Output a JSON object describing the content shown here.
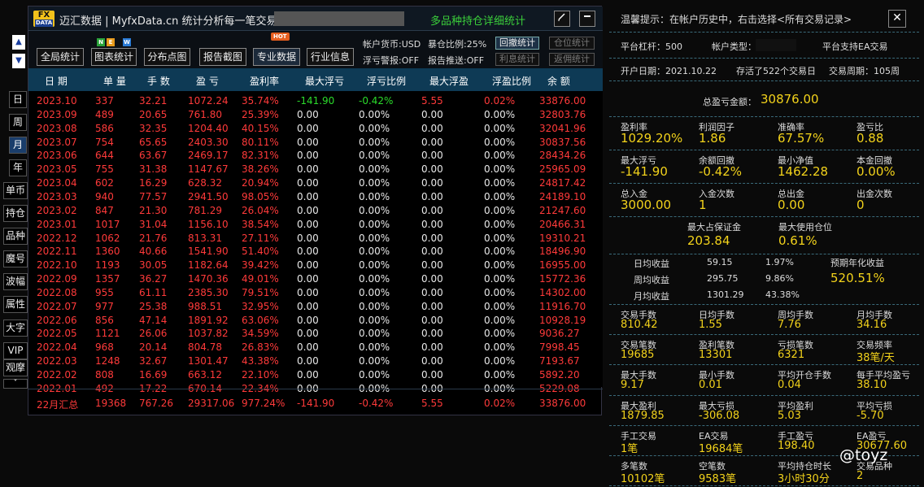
{
  "window": {
    "logo_top": "FX",
    "logo_bottom": "DATA",
    "title": "迈汇数据 | MyfxData.cn  统计分析每一笔交易",
    "subtitle": "多品种持仓详细统计",
    "edit_icon": "edit-icon",
    "minimize_icon": "minimize-icon"
  },
  "toolbar": {
    "buttons": [
      "全局统计",
      "图表统计",
      "分布点图",
      "报告截图",
      "专业数据",
      "行业信息"
    ],
    "badge_new": [
      "N",
      "E",
      "W"
    ],
    "badge_hot": "HOT",
    "account_currency": "帐户货币:USD",
    "exposure_ratio": "暴仓比例:25%",
    "float_warning": "浮亏警报:OFF",
    "report_push": "报告推送:OFF",
    "small_buttons": [
      "回撤统计",
      "仓位统计",
      "利息统计",
      "返佣统计"
    ]
  },
  "nav": {
    "up_icon": "▲",
    "down_icon": "▼",
    "items": [
      "日",
      "周",
      "月",
      "年",
      "单币",
      "持仓",
      "品种",
      "魔号",
      "波幅",
      "属性",
      "大字",
      "VIP",
      "观摩"
    ],
    "selected": "月",
    "more_icon": "˅"
  },
  "table": {
    "headers": [
      "日 期",
      "单 量",
      "手 数",
      "盈 亏",
      "盈利率",
      "最大浮亏",
      "浮亏比例",
      "最大浮盈",
      "浮盈比例",
      "余 额"
    ],
    "rows": [
      [
        "2023.10",
        "337",
        "32.21",
        "1072.24",
        "35.74%",
        "-141.90",
        "-0.42%",
        "5.55",
        "0.02%",
        "33876.00"
      ],
      [
        "2023.09",
        "489",
        "20.65",
        "761.80",
        "25.39%",
        "0.00",
        "0.00%",
        "0.00",
        "0.00%",
        "32803.76"
      ],
      [
        "2023.08",
        "586",
        "32.35",
        "1204.40",
        "40.15%",
        "0.00",
        "0.00%",
        "0.00",
        "0.00%",
        "32041.96"
      ],
      [
        "2023.07",
        "754",
        "65.65",
        "2403.30",
        "80.11%",
        "0.00",
        "0.00%",
        "0.00",
        "0.00%",
        "30837.56"
      ],
      [
        "2023.06",
        "644",
        "63.67",
        "2469.17",
        "82.31%",
        "0.00",
        "0.00%",
        "0.00",
        "0.00%",
        "28434.26"
      ],
      [
        "2023.05",
        "755",
        "31.38",
        "1147.67",
        "38.26%",
        "0.00",
        "0.00%",
        "0.00",
        "0.00%",
        "25965.09"
      ],
      [
        "2023.04",
        "602",
        "16.29",
        "628.32",
        "20.94%",
        "0.00",
        "0.00%",
        "0.00",
        "0.00%",
        "24817.42"
      ],
      [
        "2023.03",
        "940",
        "77.57",
        "2941.50",
        "98.05%",
        "0.00",
        "0.00%",
        "0.00",
        "0.00%",
        "24189.10"
      ],
      [
        "2023.02",
        "847",
        "21.30",
        "781.29",
        "26.04%",
        "0.00",
        "0.00%",
        "0.00",
        "0.00%",
        "21247.60"
      ],
      [
        "2023.01",
        "1017",
        "31.04",
        "1156.10",
        "38.54%",
        "0.00",
        "0.00%",
        "0.00",
        "0.00%",
        "20466.31"
      ],
      [
        "2022.12",
        "1062",
        "21.76",
        "813.31",
        "27.11%",
        "0.00",
        "0.00%",
        "0.00",
        "0.00%",
        "19310.21"
      ],
      [
        "2022.11",
        "1360",
        "40.66",
        "1541.90",
        "51.40%",
        "0.00",
        "0.00%",
        "0.00",
        "0.00%",
        "18496.90"
      ],
      [
        "2022.10",
        "1193",
        "30.05",
        "1182.64",
        "39.42%",
        "0.00",
        "0.00%",
        "0.00",
        "0.00%",
        "16955.00"
      ],
      [
        "2022.09",
        "1357",
        "36.27",
        "1470.36",
        "49.01%",
        "0.00",
        "0.00%",
        "0.00",
        "0.00%",
        "15772.36"
      ],
      [
        "2022.08",
        "955",
        "61.11",
        "2385.30",
        "79.51%",
        "0.00",
        "0.00%",
        "0.00",
        "0.00%",
        "14302.00"
      ],
      [
        "2022.07",
        "977",
        "25.38",
        "988.51",
        "32.95%",
        "0.00",
        "0.00%",
        "0.00",
        "0.00%",
        "11916.70"
      ],
      [
        "2022.06",
        "856",
        "47.14",
        "1891.92",
        "63.06%",
        "0.00",
        "0.00%",
        "0.00",
        "0.00%",
        "10928.19"
      ],
      [
        "2022.05",
        "1121",
        "26.06",
        "1037.82",
        "34.59%",
        "0.00",
        "0.00%",
        "0.00",
        "0.00%",
        "9036.27"
      ],
      [
        "2022.04",
        "968",
        "20.14",
        "804.78",
        "26.83%",
        "0.00",
        "0.00%",
        "0.00",
        "0.00%",
        "7998.45"
      ],
      [
        "2022.03",
        "1248",
        "32.67",
        "1301.47",
        "43.38%",
        "0.00",
        "0.00%",
        "0.00",
        "0.00%",
        "7193.67"
      ],
      [
        "2022.02",
        "808",
        "16.69",
        "663.12",
        "22.10%",
        "0.00",
        "0.00%",
        "0.00",
        "0.00%",
        "5892.20"
      ],
      [
        "2022.01",
        "492",
        "17.22",
        "670.14",
        "22.34%",
        "0.00",
        "0.00%",
        "0.00",
        "0.00%",
        "5229.08"
      ]
    ],
    "summary": [
      "22月汇总",
      "19368",
      "767.26",
      "29317.06",
      "977.24%",
      "-141.90",
      "-0.42%",
      "5.55",
      "0.02%",
      "33876.00"
    ]
  },
  "right": {
    "hint": "温馨提示：在帐户历史中，右击选择<所有交易记录>",
    "close_icon": "✕",
    "leverage": "平台杠杆：500",
    "account_type": "帐户类型：",
    "ea_support": "平台支持EA交易",
    "open_date": "开户日期：2021.10.22",
    "survived": "存活了522个交易日",
    "cycle": "交易周期：105周",
    "total_pl_label": "总盈亏金额：",
    "total_pl_value": "30876.00",
    "grid1": [
      {
        "l": "盈利率",
        "v": "1029.20%"
      },
      {
        "l": "利润因子",
        "v": "1.86"
      },
      {
        "l": "准确率",
        "v": "67.57%"
      },
      {
        "l": "盈亏比",
        "v": "0.88"
      },
      {
        "l": "最大浮亏",
        "v": "-141.90"
      },
      {
        "l": "余额回撤",
        "v": "-0.42%"
      },
      {
        "l": "最小净值",
        "v": "1462.28"
      },
      {
        "l": "本金回撤",
        "v": "0.00%"
      },
      {
        "l": "总入金",
        "v": "3000.00"
      },
      {
        "l": "入金次数",
        "v": "1"
      },
      {
        "l": "总出金",
        "v": "0.00"
      },
      {
        "l": "出金次数",
        "v": "0"
      }
    ],
    "max_margin_label": "最大占保证金",
    "max_margin_value": "203.84",
    "max_position_label": "最大使用仓位",
    "max_position_value": "0.61%",
    "income": [
      {
        "l": "日均收益",
        "a": "59.15",
        "p": "1.97%"
      },
      {
        "l": "周均收益",
        "a": "295.75",
        "p": "9.86%"
      },
      {
        "l": "月均收益",
        "a": "1301.29",
        "p": "43.38%"
      }
    ],
    "annual_label": "预期年化收益",
    "annual_value": "520.51%",
    "grid2": [
      {
        "l": "交易手数",
        "v": "810.42"
      },
      {
        "l": "日均手数",
        "v": "1.55"
      },
      {
        "l": "周均手数",
        "v": "7.76"
      },
      {
        "l": "月均手数",
        "v": "34.16"
      },
      {
        "l": "交易笔数",
        "v": "19685"
      },
      {
        "l": "盈利笔数",
        "v": "13301"
      },
      {
        "l": "亏损笔数",
        "v": "6321"
      },
      {
        "l": "交易频率",
        "v": "38笔/天"
      },
      {
        "l": "最大手数",
        "v": "9.17"
      },
      {
        "l": "最小手数",
        "v": "0.01"
      },
      {
        "l": "平均开仓手数",
        "v": "0.04"
      },
      {
        "l": "每手平均盈亏",
        "v": "38.10"
      },
      {
        "l": "最大盈利",
        "v": "1879.85"
      },
      {
        "l": "最大亏损",
        "v": "-306.08"
      },
      {
        "l": "平均盈利",
        "v": "5.03"
      },
      {
        "l": "平均亏损",
        "v": "-5.70"
      },
      {
        "l": "手工交易",
        "v": "1笔"
      },
      {
        "l": "EA交易",
        "v": "19684笔"
      },
      {
        "l": "手工盈亏",
        "v": "198.40"
      },
      {
        "l": "EA盈亏",
        "v": "30677.60"
      },
      {
        "l": "多笔数",
        "v": "10102笔"
      },
      {
        "l": "空笔数",
        "v": "9583笔"
      },
      {
        "l": "平均持仓时长",
        "v": "3小时30分"
      },
      {
        "l": "交易品种",
        "v": "2"
      }
    ]
  },
  "watermark": "@toyz"
}
